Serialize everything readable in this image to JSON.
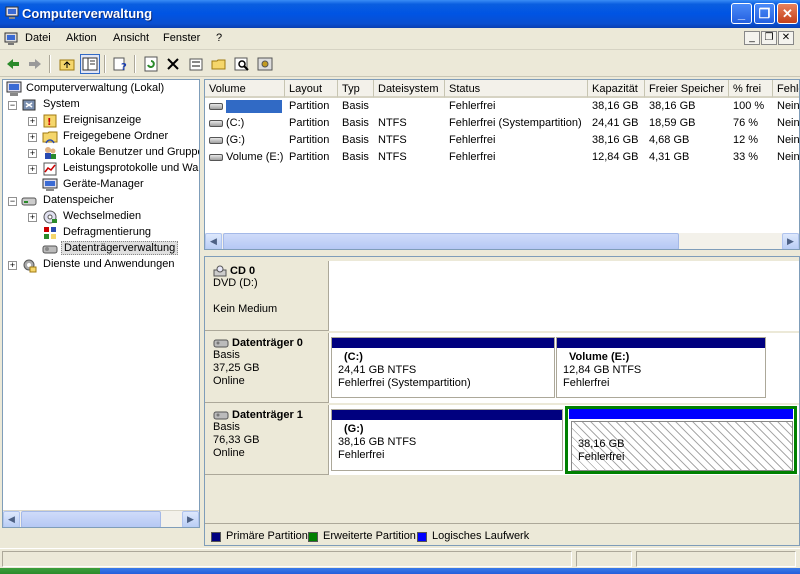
{
  "window": {
    "title": "Computerverwaltung",
    "controls": {
      "minimize": "_",
      "restore": "❐",
      "close": "✕"
    }
  },
  "menu": {
    "items": [
      "Datei",
      "Aktion",
      "Ansicht",
      "Fenster",
      "?"
    ],
    "mdi_controls": {
      "minimize": "_",
      "restore": "❐",
      "close": "✕"
    }
  },
  "toolbar": {
    "icons": [
      "back-arrow-icon",
      "forward-arrow-icon",
      "up-folder-icon",
      "show-hide-tree-icon",
      "properties-help-icon",
      "refresh-icon",
      "delete-icon",
      "properties-icon",
      "open-folder-icon",
      "search-icon",
      "settings-icon"
    ]
  },
  "tree": {
    "root": "Computerverwaltung (Lokal)",
    "system": "System",
    "system_children": [
      "Ereignisanzeige",
      "Freigegebene Ordner",
      "Lokale Benutzer und Gruppen",
      "Leistungsprotokolle und Warnungen",
      "Geräte-Manager"
    ],
    "storage": "Datenspeicher",
    "storage_children": [
      "Wechselmedien",
      "Defragmentierung",
      "Datenträgerverwaltung"
    ],
    "services": "Dienste und Anwendungen"
  },
  "volume_list": {
    "columns": [
      "Volume",
      "Layout",
      "Typ",
      "Dateisystem",
      "Status",
      "Kapazität",
      "Freier Speicher",
      "% frei",
      "Fehlertoleranz"
    ],
    "rows": [
      {
        "volume": "",
        "layout": "Partition",
        "typ": "Basis",
        "fs": "",
        "status": "Fehlerfrei",
        "kapazitaet": "38,16 GB",
        "frei": "38,16 GB",
        "prozent": "100 %",
        "fehler": "Nein"
      },
      {
        "volume": "(C:)",
        "layout": "Partition",
        "typ": "Basis",
        "fs": "NTFS",
        "status": "Fehlerfrei (Systempartition)",
        "kapazitaet": "24,41 GB",
        "frei": "18,59 GB",
        "prozent": "76 %",
        "fehler": "Nein"
      },
      {
        "volume": "(G:)",
        "layout": "Partition",
        "typ": "Basis",
        "fs": "NTFS",
        "status": "Fehlerfrei",
        "kapazitaet": "38,16 GB",
        "frei": "4,68 GB",
        "prozent": "12 %",
        "fehler": "Nein"
      },
      {
        "volume": "Volume (E:)",
        "layout": "Partition",
        "typ": "Basis",
        "fs": "NTFS",
        "status": "Fehlerfrei",
        "kapazitaet": "12,84 GB",
        "frei": "4,31 GB",
        "prozent": "33 %",
        "fehler": "Nein"
      }
    ]
  },
  "disks": {
    "cd0": {
      "name": "CD 0",
      "line1": "DVD (D:)",
      "line2": "Kein Medium"
    },
    "disk0": {
      "name": "Datenträger 0",
      "type": "Basis",
      "size": "37,25 GB",
      "state": "Online",
      "partitions": [
        {
          "label": "(C:)",
          "size": "24,41 GB NTFS",
          "status": "Fehlerfrei (Systempartition)"
        },
        {
          "label": "Volume  (E:)",
          "size": "12,84 GB NTFS",
          "status": "Fehlerfrei"
        }
      ]
    },
    "disk1": {
      "name": "Datenträger 1",
      "type": "Basis",
      "size": "76,33 GB",
      "state": "Online",
      "partitions": [
        {
          "label": "(G:)",
          "size": "38,16 GB NTFS",
          "status": "Fehlerfrei"
        },
        {
          "label": "",
          "size": "38,16 GB",
          "status": "Fehlerfrei"
        }
      ]
    }
  },
  "legend": {
    "items": [
      {
        "label": "Primäre Partition",
        "color": "#00007f"
      },
      {
        "label": "Erweiterte Partition",
        "color": "#008000"
      },
      {
        "label": "Logisches Laufwerk",
        "color": "#0000ff"
      }
    ]
  }
}
